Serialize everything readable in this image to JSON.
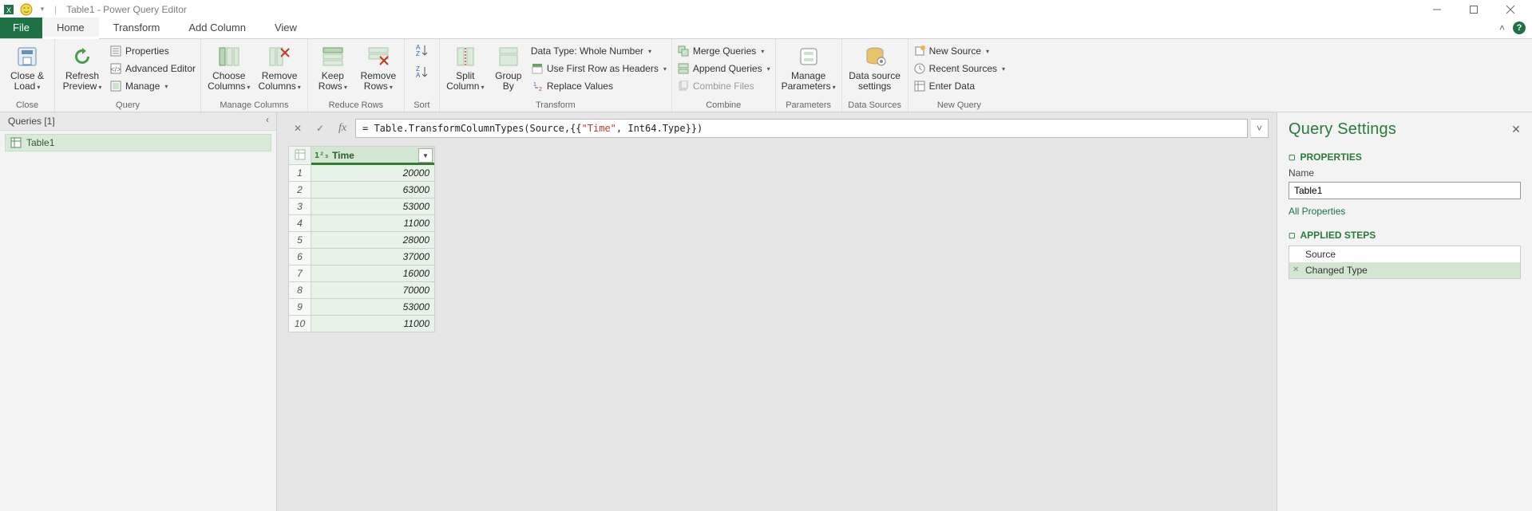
{
  "titlebar": {
    "title": "Table1 - Power Query Editor"
  },
  "tabs": {
    "file": "File",
    "home": "Home",
    "transform": "Transform",
    "addcolumn": "Add Column",
    "view": "View"
  },
  "ribbon": {
    "close": {
      "closeLoad": "Close &\nLoad",
      "group": "Close"
    },
    "query": {
      "refresh": "Refresh\nPreview",
      "properties": "Properties",
      "advanced": "Advanced Editor",
      "manage": "Manage",
      "group": "Query"
    },
    "managecols": {
      "choose": "Choose\nColumns",
      "remove": "Remove\nColumns",
      "group": "Manage Columns"
    },
    "reducerows": {
      "keep": "Keep\nRows",
      "remove": "Remove\nRows",
      "group": "Reduce Rows"
    },
    "sort": {
      "group": "Sort"
    },
    "transform": {
      "split": "Split\nColumn",
      "groupby": "Group\nBy",
      "datatype": "Data Type: Whole Number",
      "firstrow": "Use First Row as Headers",
      "replace": "Replace Values",
      "group": "Transform"
    },
    "combine": {
      "merge": "Merge Queries",
      "append": "Append Queries",
      "combinefiles": "Combine Files",
      "group": "Combine"
    },
    "parameters": {
      "manage": "Manage\nParameters",
      "group": "Parameters"
    },
    "datasources": {
      "settings": "Data source\nsettings",
      "group": "Data Sources"
    },
    "newquery": {
      "newsource": "New Source",
      "recent": "Recent Sources",
      "enterdata": "Enter Data",
      "group": "New Query"
    }
  },
  "queriesPane": {
    "header": "Queries [1]",
    "items": [
      "Table1"
    ]
  },
  "formulaBar": {
    "prefix": "= Table.TransformColumnTypes(Source,{{",
    "string": "\"Time\"",
    "suffix": ", Int64.Type}})"
  },
  "grid": {
    "typeSymbol": "1²₃",
    "column": "Time",
    "rows": [
      20000,
      63000,
      53000,
      11000,
      28000,
      37000,
      16000,
      70000,
      53000,
      11000
    ]
  },
  "settings": {
    "title": "Query Settings",
    "propsHeader": "PROPERTIES",
    "nameLabel": "Name",
    "nameValue": "Table1",
    "allProps": "All Properties",
    "stepsHeader": "APPLIED STEPS",
    "steps": [
      "Source",
      "Changed Type"
    ]
  },
  "chart_data": {
    "type": "table",
    "title": "Time",
    "categories": [
      "Time"
    ],
    "values": [
      20000,
      63000,
      53000,
      11000,
      28000,
      37000,
      16000,
      70000,
      53000,
      11000
    ]
  }
}
